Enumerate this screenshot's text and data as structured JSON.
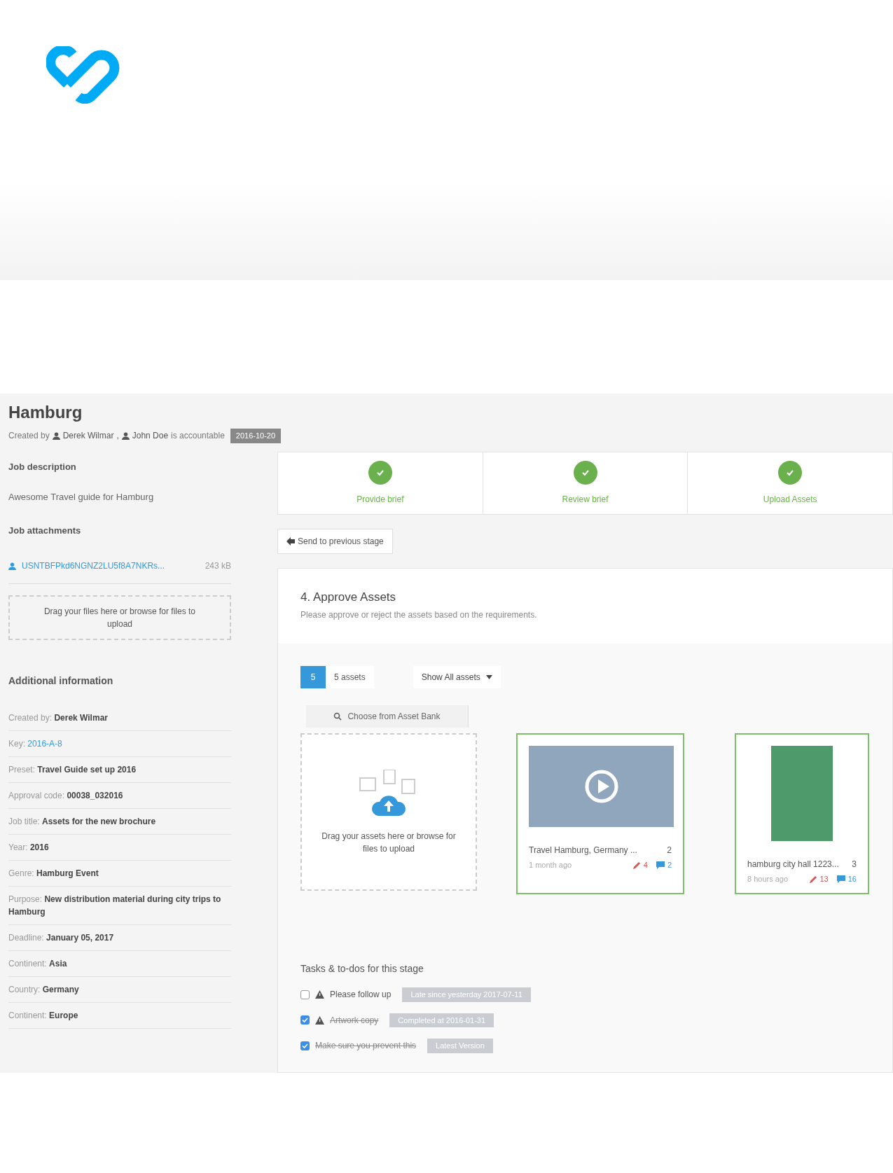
{
  "header": {
    "title": "Hamburg",
    "created_label": "Created by",
    "users": [
      "Derek Wilmar",
      "John Doe"
    ],
    "separator": ",",
    "accountable_label": "is accountable",
    "date_badge": "2016-10-20"
  },
  "sidebar": {
    "description_title": "Job description",
    "description": "Awesome Travel guide for Hamburg",
    "attachments_title": "Job attachments",
    "attachments": [
      {
        "name": "USNTBFPkd6NGNZ2LU5f8A7NKRs...",
        "size": "243 kB"
      }
    ],
    "dropzone": "Drag your files here or browse for files to upload",
    "info_title": "Additional information",
    "info": [
      {
        "label": "Created by:",
        "value": "Derek Wilmar",
        "kind": "text"
      },
      {
        "label": "Key:",
        "value": "2016-A-8",
        "kind": "link"
      },
      {
        "label": "Preset:",
        "value": "Travel Guide set up 2016",
        "kind": "text"
      },
      {
        "label": "Approval code:",
        "value": "00038_032016",
        "kind": "text"
      },
      {
        "label": "Job title:",
        "value": "Assets for the new brochure",
        "kind": "text"
      },
      {
        "label": "Year:",
        "value": "2016",
        "kind": "text"
      },
      {
        "label": "Genre:",
        "value": "Hamburg Event",
        "kind": "text"
      },
      {
        "label": "Purpose:",
        "value": "New distribution material during city trips to Hamburg",
        "kind": "text"
      },
      {
        "label": "Deadline:",
        "value": "January 05, 2017",
        "kind": "text"
      },
      {
        "label": "Continent:",
        "value": "Asia",
        "kind": "text"
      },
      {
        "label": "Country:",
        "value": "Germany",
        "kind": "text"
      },
      {
        "label": "Continent:",
        "value": "Europe",
        "kind": "text"
      }
    ]
  },
  "steps": [
    {
      "label": "Provide brief",
      "done": true
    },
    {
      "label": "Review brief",
      "done": true
    },
    {
      "label": "Upload Assets",
      "done": true
    }
  ],
  "back_button": "Send to previous stage",
  "stage": {
    "title": "4. Approve Assets",
    "subtitle": "Please approve or reject the assets based on the requirements.",
    "count_badge": "5",
    "count_label": "5 assets",
    "filter": "Show All assets",
    "bank_button": "Choose from Asset Bank",
    "upload_text": "Drag your assets here or browse for files to upload",
    "assets": [
      {
        "kind": "video",
        "title": "Travel Hamburg, Germany ...",
        "version": "2",
        "age": "1 month ago",
        "edits": "4",
        "comments": "2",
        "approved": true
      },
      {
        "kind": "image",
        "title": "hamburg city hall 1223...",
        "version": "3",
        "age": "8 hours ago",
        "edits": "13",
        "comments": "16",
        "approved": true
      }
    ]
  },
  "tasks": {
    "title": "Tasks & to-dos for this stage",
    "items": [
      {
        "text": "Please follow up",
        "checked": false,
        "warning": true,
        "badge": "Late since yesterday 2017-07-11"
      },
      {
        "text": "Artwork copy",
        "checked": true,
        "warning": true,
        "badge": "Completed at 2016-01-31"
      },
      {
        "text": "Make sure you prevent this",
        "checked": true,
        "warning": false,
        "badge": "Latest Version"
      }
    ]
  }
}
